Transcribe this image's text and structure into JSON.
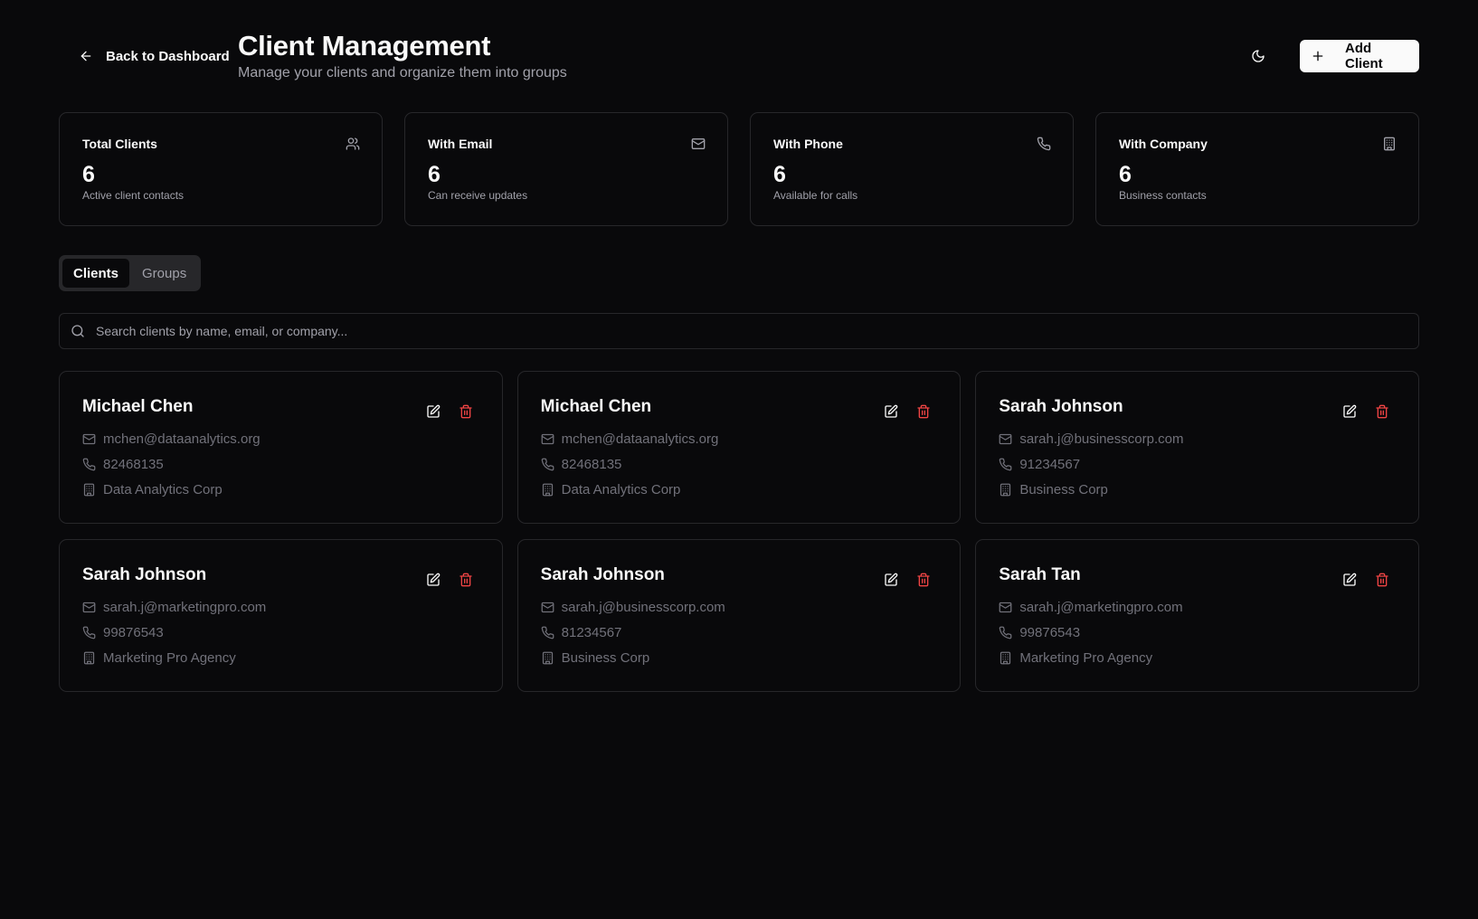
{
  "header": {
    "back_label": "Back to Dashboard",
    "title": "Client Management",
    "subtitle": "Manage your clients and organize them into groups",
    "add_label": "Add Client"
  },
  "stats": [
    {
      "title": "Total Clients",
      "value": "6",
      "desc": "Active client contacts",
      "icon": "users-icon"
    },
    {
      "title": "With Email",
      "value": "6",
      "desc": "Can receive updates",
      "icon": "mail-icon"
    },
    {
      "title": "With Phone",
      "value": "6",
      "desc": "Available for calls",
      "icon": "phone-icon"
    },
    {
      "title": "With Company",
      "value": "6",
      "desc": "Business contacts",
      "icon": "building-icon"
    }
  ],
  "tabs": [
    {
      "label": "Clients",
      "active": true
    },
    {
      "label": "Groups",
      "active": false
    }
  ],
  "search": {
    "placeholder": "Search clients by name, email, or company..."
  },
  "clients": [
    {
      "name": "Michael Chen",
      "email": "mchen@dataanalytics.org",
      "phone": "82468135",
      "company": "Data Analytics Corp"
    },
    {
      "name": "Michael Chen",
      "email": "mchen@dataanalytics.org",
      "phone": "82468135",
      "company": "Data Analytics Corp"
    },
    {
      "name": "Sarah Johnson",
      "email": "sarah.j@businesscorp.com",
      "phone": "91234567",
      "company": "Business Corp"
    },
    {
      "name": "Sarah Johnson",
      "email": "sarah.j@marketingpro.com",
      "phone": "99876543",
      "company": "Marketing Pro Agency"
    },
    {
      "name": "Sarah Johnson",
      "email": "sarah.j@businesscorp.com",
      "phone": "81234567",
      "company": "Business Corp"
    },
    {
      "name": "Sarah Tan",
      "email": "sarah.j@marketingpro.com",
      "phone": "99876543",
      "company": "Marketing Pro Agency"
    }
  ],
  "colors": {
    "background": "#09090b",
    "border": "#27272a",
    "muted_text": "#a1a1aa",
    "info_text": "#71717a",
    "danger": "#ef4444",
    "primary_button": "#fafafa"
  }
}
